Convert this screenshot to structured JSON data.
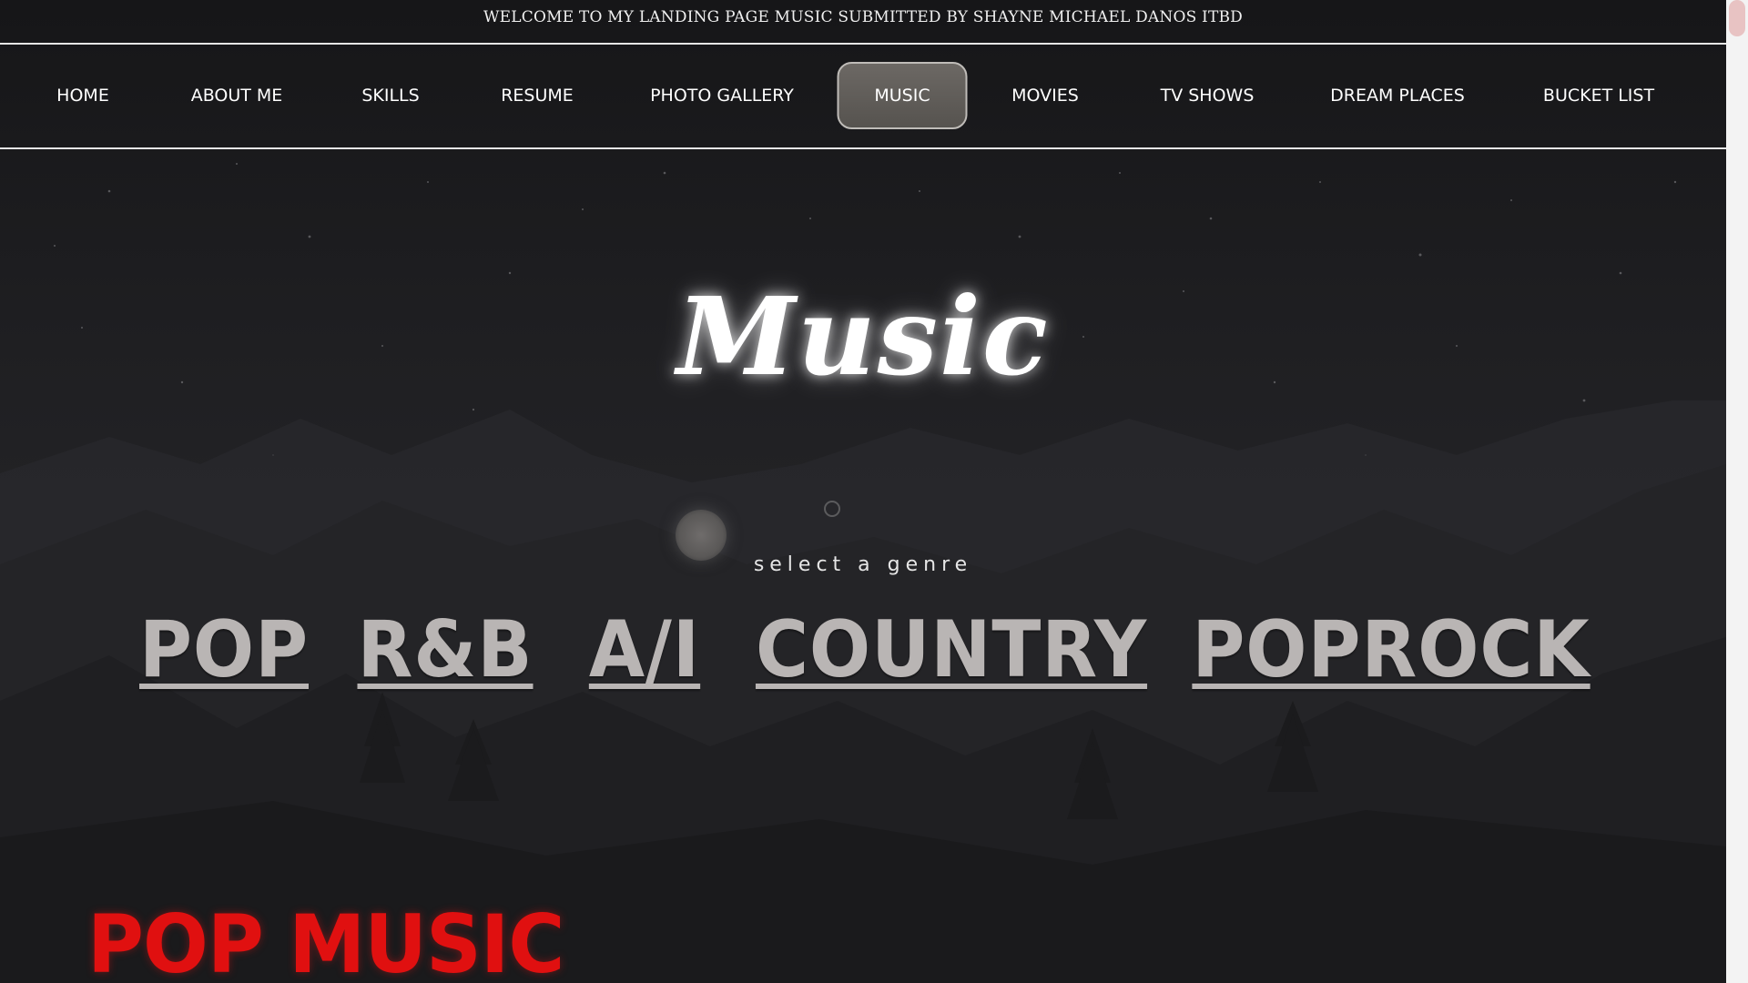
{
  "header": {
    "welcome_text": "WELCOME TO MY LANDING PAGE MUSIC SUBMITTED BY SHAYNE MICHAEL DANOS ITBD"
  },
  "nav": {
    "items": [
      {
        "label": "HOME"
      },
      {
        "label": "ABOUT ME"
      },
      {
        "label": "SKILLS"
      },
      {
        "label": "RESUME"
      },
      {
        "label": "PHOTO GALLERY"
      },
      {
        "label": "MUSIC",
        "active": true
      },
      {
        "label": "MOVIES"
      },
      {
        "label": "TV SHOWS"
      },
      {
        "label": "DREAM PLACES"
      },
      {
        "label": "BUCKET LIST"
      }
    ]
  },
  "hero": {
    "title": "Music",
    "subtitle": "select a genre"
  },
  "genres": [
    {
      "label": "POP"
    },
    {
      "label": "R&B"
    },
    {
      "label": "A/I"
    },
    {
      "label": "COUNTRY"
    },
    {
      "label": "POPROCK"
    }
  ],
  "section": {
    "title": "POP MUSIC"
  },
  "colors": {
    "accent_red": "#e01010",
    "genre_link": "#b9b5b4",
    "nav_active_bg": "#615e5a"
  }
}
